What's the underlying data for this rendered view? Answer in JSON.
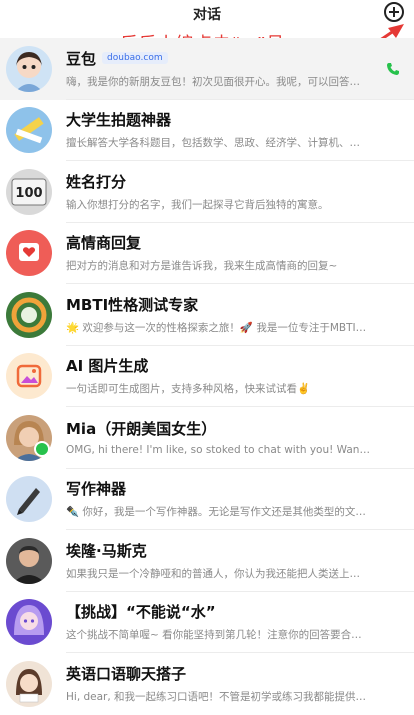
{
  "header": {
    "title": "对话"
  },
  "annotation": {
    "text": "乐乐小编点击“+”号"
  },
  "colors": {
    "annotation": "#e53935",
    "badge": "#3a6ee8",
    "call": "#27c24c"
  },
  "chats": [
    {
      "name": "豆包",
      "badge": "doubao.com",
      "preview": "嗨，我是你的新朋友豆包！初次见面很开心。我呢，可以回答你的各种...",
      "avatar_icon": "girl-portrait-icon",
      "avatar_bg": "#cfe3f5"
    },
    {
      "name": "大学生拍题神器",
      "preview": "擅长解答大学各科题目，包括数学、思政、经济学、计算机、机械、法...",
      "avatar_icon": "pencil-ruler-icon",
      "avatar_bg": "#8ec2ea"
    },
    {
      "name": "姓名打分",
      "preview": "输入你想打分的名字，我们一起探寻它背后独特的寓意。",
      "avatar_icon": "score-100-icon",
      "avatar_bg": "#d9d9d9"
    },
    {
      "name": "高情商回复",
      "preview": "把对方的消息和对方是谁告诉我，我来生成高情商的回复~",
      "avatar_icon": "heart-card-icon",
      "avatar_bg": "#ef5d57"
    },
    {
      "name": "MBTI性格测试专家",
      "preview": "🌟 欢迎参与这一次的性格探索之旅！🚀 我是一位专注于MBTI性格类型...",
      "avatar_icon": "personality-ring-icon",
      "avatar_bg": "#3c7a3a"
    },
    {
      "name": "AI 图片生成",
      "preview": "一句话即可生成图片，支持多种风格，快来试试看✌️",
      "avatar_icon": "image-sparkle-icon",
      "avatar_bg": "#fde9cf"
    },
    {
      "name": "Mia（开朗美国女生）",
      "preview": "OMG, hi there! I'm like, so stoked to chat with you! Wanna practice some...",
      "avatar_icon": "woman-portrait-icon",
      "avatar_bg": "#c9a07a"
    },
    {
      "name": "写作神器",
      "preview": "✒️ 你好，我是一个写作神器。无论是写作文还是其他类型的文字创作，...",
      "avatar_icon": "pen-nib-icon",
      "avatar_bg": "#cfdff2"
    },
    {
      "name": "埃隆·马斯克",
      "preview": "如果我只是一个冷静哑和的普通人，你认为我还能把人类送上火星么?",
      "avatar_icon": "man-portrait-icon",
      "avatar_bg": "#5a5a5a"
    },
    {
      "name": "【挑战】“不能说“水”",
      "preview": "这个挑战不简单喔~ 看你能坚持到第几轮！注意你的回答要合情合理喔~",
      "avatar_icon": "anime-girl-icon",
      "avatar_bg": "#6b4bd0"
    },
    {
      "name": "英语口语聊天搭子",
      "preview": "Hi, dear, 和我一起练习口语吧！不管是初学或练习我都能提供个性化的学...",
      "avatar_icon": "girl-reader-icon",
      "avatar_bg": "#f0e3d6"
    }
  ]
}
